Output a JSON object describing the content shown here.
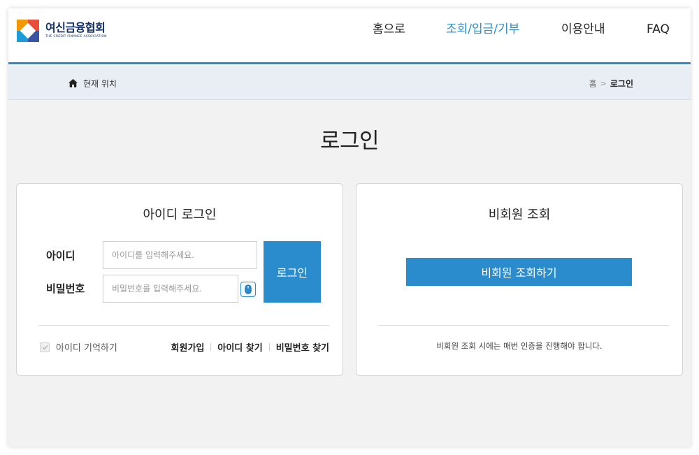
{
  "header": {
    "logo": {
      "name_ko": "여신금융협회",
      "name_en": "THE CREDIT FINANCE ASSOCIATION"
    },
    "nav": [
      {
        "label": "홈으로",
        "active": false
      },
      {
        "label": "조회/입금/기부",
        "active": true
      },
      {
        "label": "이용안내",
        "active": false
      },
      {
        "label": "FAQ",
        "active": false
      }
    ]
  },
  "breadcrumb": {
    "location_label": "현재 위치",
    "home": "홈",
    "separator": ">",
    "current": "로그인"
  },
  "page_title": "로그인",
  "id_login": {
    "title": "아이디 로그인",
    "id_label": "아이디",
    "id_placeholder": "아이디를 입력해주세요.",
    "id_value": "",
    "pw_label": "비밀번호",
    "pw_placeholder": "비밀번호를 입력해주세요.",
    "pw_value": "",
    "login_button": "로그인",
    "remember_label": "아이디 기억하기",
    "links": [
      "회원가입",
      "아이디 찾기",
      "비밀번호 찾기"
    ]
  },
  "guest": {
    "title": "비회원 조회",
    "button": "비회원 조회하기",
    "note": "비회원 조회 시에는 매번 인증을 진행해야 합니다."
  },
  "colors": {
    "accent": "#2b8ccd",
    "brand_navy": "#14326b",
    "breadcrumb_bg": "#e9eef5",
    "page_bg": "#f2f2f2"
  },
  "icons": {
    "home": "home-icon",
    "mouse": "mouse-icon",
    "check": "check-icon"
  }
}
